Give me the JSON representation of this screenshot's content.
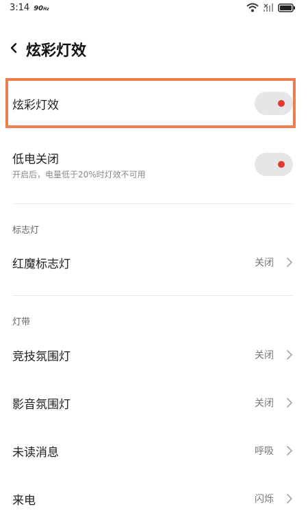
{
  "status_bar": {
    "time": "3:14",
    "refresh_rate": "90",
    "refresh_unit": "Hz",
    "icons": [
      "wifi-icon",
      "signal-icon",
      "battery-icon"
    ]
  },
  "header": {
    "back_icon": "chevron-left-icon",
    "title": "炫彩灯效"
  },
  "toggles": [
    {
      "label": "炫彩灯效",
      "subtitle": "",
      "on": true
    },
    {
      "label": "低电关闭",
      "subtitle": "开启后，电量低于20%时灯效不可用",
      "on": true
    }
  ],
  "sections": [
    {
      "title": "标志灯",
      "items": [
        {
          "label": "红魔标志灯",
          "value": "关闭"
        }
      ]
    },
    {
      "title": "灯带",
      "items": [
        {
          "label": "竞技氛围灯",
          "value": "关闭"
        },
        {
          "label": "影音氛围灯",
          "value": "关闭"
        },
        {
          "label": "未读消息",
          "value": "呼吸"
        },
        {
          "label": "来电",
          "value": "闪烁"
        }
      ]
    }
  ],
  "colors": {
    "accent": "#e33a30",
    "highlight": "#ee7c4e",
    "toggle_track": "#e6e6e9"
  }
}
